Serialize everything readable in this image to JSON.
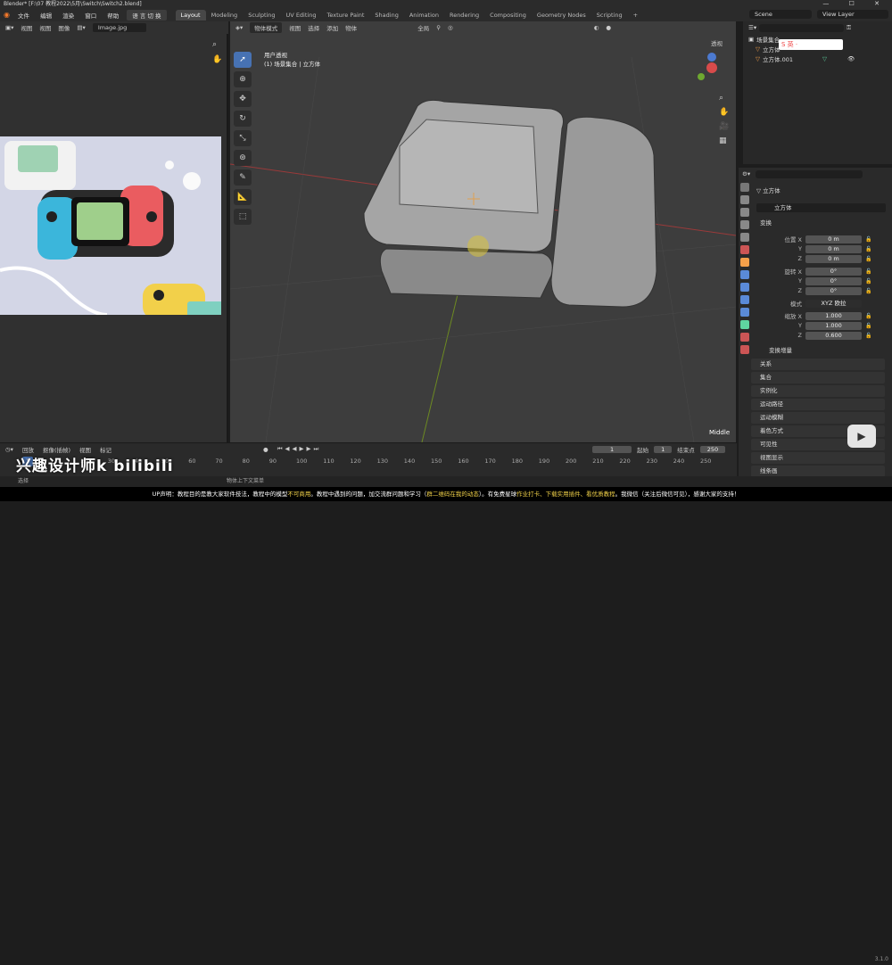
{
  "window": {
    "title": "Blender* [F:\\07 教程2022\\5月\\Switch\\Switch2.blend]"
  },
  "menu": {
    "items": [
      "文件",
      "编辑",
      "渲染",
      "窗口",
      "帮助"
    ],
    "switch_btn": "语 言 切 换",
    "workspaces": [
      "Layout",
      "Modeling",
      "Sculpting",
      "UV Editing",
      "Texture Paint",
      "Shading",
      "Animation",
      "Rendering",
      "Compositing",
      "Geometry Nodes",
      "Scripting"
    ],
    "active_workspace": "Layout",
    "scene": "Scene",
    "view_layer": "View Layer"
  },
  "image_editor": {
    "menus": [
      "视图",
      "视图",
      "图像"
    ],
    "image_name": "Image.jpg"
  },
  "viewport": {
    "mode": "物体模式",
    "menus": [
      "视图",
      "选择",
      "添加",
      "物体"
    ],
    "transform_space": "全局",
    "overlay_label": "透视",
    "view_name": "用户透视",
    "collection_line": "(1) 场景集合 | 立方体",
    "pivot_label": "Middle"
  },
  "outliner": {
    "rows": [
      {
        "label": "场景集合",
        "indent": 0
      },
      {
        "label": "立方体",
        "indent": 1
      },
      {
        "label": "立方体.001",
        "indent": 1
      }
    ]
  },
  "properties": {
    "object_name": "立方体",
    "object_field": "立方体",
    "transform_header": "变换",
    "location": {
      "label": "位置 X",
      "y_label": "Y",
      "z_label": "Z",
      "x": "0 m",
      "y": "0 m",
      "z": "0 m"
    },
    "rotation": {
      "label": "旋转 X",
      "y_label": "Y",
      "z_label": "Z",
      "x": "0°",
      "y": "0°",
      "z": "0°"
    },
    "mode": {
      "label": "模式",
      "value": "XYZ 欧拉"
    },
    "scale": {
      "label": "缩放 X",
      "y_label": "Y",
      "z_label": "Z",
      "x": "1.000",
      "y": "1.000",
      "z": "0.600"
    },
    "sections": [
      "变换增量",
      "关系",
      "集合",
      "实例化",
      "运动路径",
      "运动模糊",
      "着色方式",
      "可见性",
      "视图显示",
      "线条画"
    ]
  },
  "timeline": {
    "menus": [
      "回放",
      "抠像(插帧)",
      "视图",
      "标记"
    ],
    "current_frame": "1",
    "start_label": "起始",
    "start": "1",
    "end_label": "结束点",
    "end": "250",
    "ruler": [
      "1",
      "10",
      "20",
      "30",
      "40",
      "50",
      "60",
      "70",
      "80",
      "90",
      "100",
      "110",
      "120",
      "130",
      "140",
      "150",
      "160",
      "170",
      "180",
      "190",
      "200",
      "210",
      "220",
      "230",
      "240",
      "250"
    ]
  },
  "status": {
    "left": "选择",
    "middle": "物体上下文菜单",
    "version": "3.1.0"
  },
  "subtitle": {
    "pre": "UP声明：教程目的是教大家软件技法，教程中的模型",
    "hl1": "不可商用",
    "mid1": "。教程中遇到的问题，加交流群问题和学习（",
    "hl2": "群二维码在我的动态",
    "mid2": "）。有免费星球",
    "hl3": "作业打卡、下载实用插件、看优质教程",
    "post": "。我微信（关注后微信可见），感谢大家的支持！"
  },
  "watermark": {
    "text": "兴趣设计师k bilibili"
  },
  "ime": {
    "label": "S 英 ·"
  }
}
